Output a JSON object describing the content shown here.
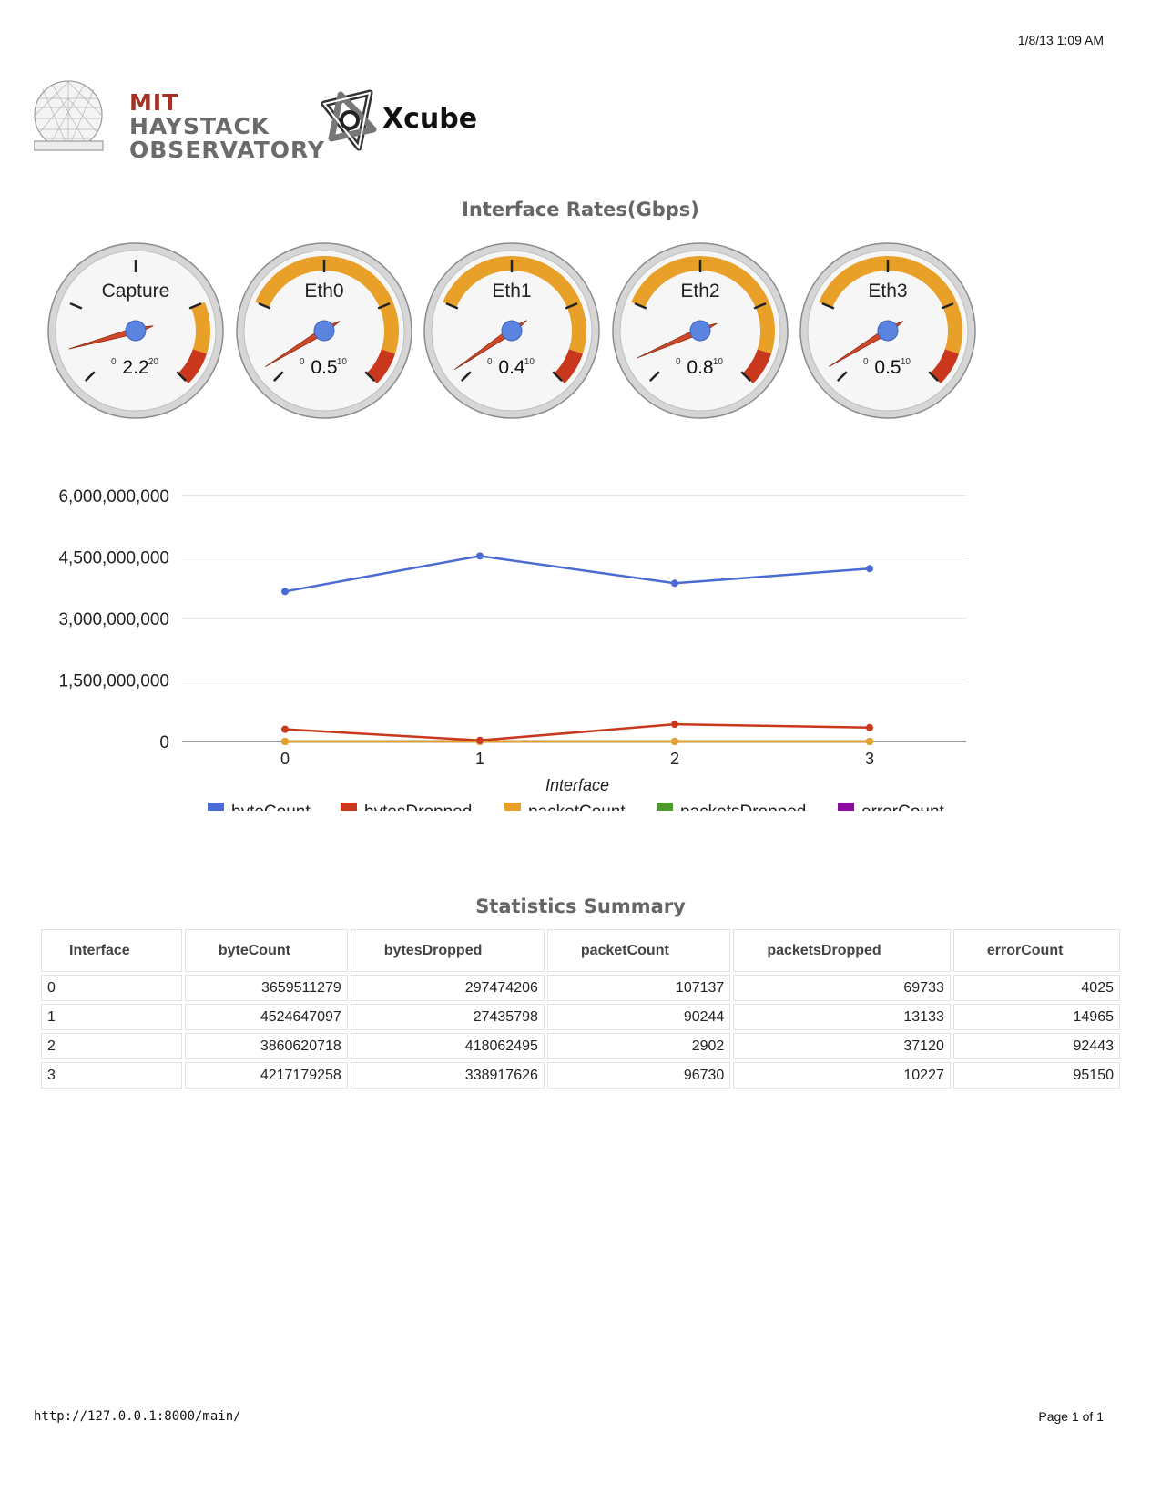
{
  "print_header": {
    "datetime": "1/8/13 1:09 AM"
  },
  "print_footer": {
    "url": "http://127.0.0.1:8000/main/",
    "page": "Page 1 of 1"
  },
  "logos": {
    "mit": {
      "line1": "MIT",
      "line2": "HAYSTACK",
      "line3": "OBSERVATORY"
    },
    "xcube": {
      "name": "Xcube"
    }
  },
  "gauges_title": "Interface Rates(Gbps)",
  "gauges": [
    {
      "label": "Capture",
      "value": 2.2,
      "display": "2.2",
      "min": 0,
      "max": 20,
      "min_label": "0",
      "max_label": "20"
    },
    {
      "label": "Eth0",
      "value": 0.5,
      "display": "0.5",
      "min": 0,
      "max": 10,
      "min_label": "0",
      "max_label": "10"
    },
    {
      "label": "Eth1",
      "value": 0.4,
      "display": "0.4",
      "min": 0,
      "max": 10,
      "min_label": "0",
      "max_label": "10"
    },
    {
      "label": "Eth2",
      "value": 0.8,
      "display": "0.8",
      "min": 0,
      "max": 10,
      "min_label": "0",
      "max_label": "10"
    },
    {
      "label": "Eth3",
      "value": 0.5,
      "display": "0.5",
      "min": 0,
      "max": 10,
      "min_label": "0",
      "max_label": "10"
    }
  ],
  "gauge_colors": {
    "yellow": "#e8a029",
    "red": "#c9371d",
    "needle": "#d0482a",
    "hub": "#5b84e0"
  },
  "chart_data": {
    "type": "line",
    "categories": [
      "0",
      "1",
      "2",
      "3"
    ],
    "xlabel": "Interface",
    "ylabel": "",
    "ylim": [
      0,
      6000000000
    ],
    "yticks": [
      "0",
      "1,500,000,000",
      "3,000,000,000",
      "4,500,000,000",
      "6,000,000,000"
    ],
    "grid": true,
    "legend": "bottom",
    "series": [
      {
        "name": "byteCount",
        "color": "#4a6bd3",
        "values": [
          3659511279,
          4524647097,
          3860620718,
          4217179258
        ]
      },
      {
        "name": "bytesDropped",
        "color": "#c9371d",
        "values": [
          297474206,
          27435798,
          418062495,
          338917626
        ]
      },
      {
        "name": "packetCount",
        "color": "#e8a029",
        "values": [
          107137,
          90244,
          2902,
          96730
        ]
      },
      {
        "name": "packetsDropped",
        "color": "#4e9a2e",
        "values": [
          69733,
          13133,
          37120,
          10227
        ]
      },
      {
        "name": "errorCount",
        "color": "#8a0d9e",
        "values": [
          4025,
          14965,
          92443,
          95150
        ]
      }
    ]
  },
  "stats_title": "Statistics Summary",
  "stats": {
    "headers": [
      "Interface",
      "byteCount",
      "bytesDropped",
      "packetCount",
      "packetsDropped",
      "errorCount"
    ],
    "rows": [
      [
        "0",
        "3659511279",
        "297474206",
        "107137",
        "69733",
        "4025"
      ],
      [
        "1",
        "4524647097",
        "27435798",
        "90244",
        "13133",
        "14965"
      ],
      [
        "2",
        "3860620718",
        "418062495",
        "2902",
        "37120",
        "92443"
      ],
      [
        "3",
        "4217179258",
        "338917626",
        "96730",
        "10227",
        "95150"
      ]
    ]
  }
}
